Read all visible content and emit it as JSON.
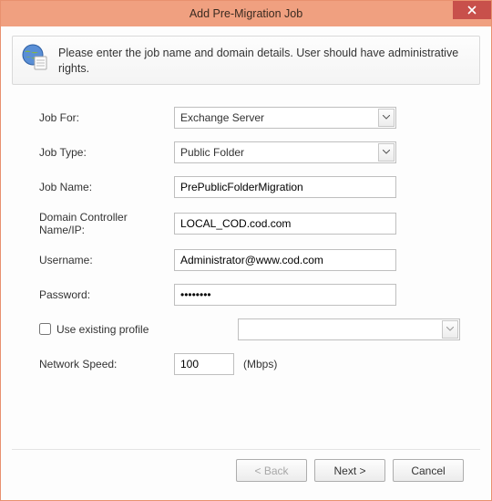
{
  "window": {
    "title": "Add Pre-Migration Job"
  },
  "banner": {
    "text": "Please enter the job name and domain details. User should have administrative rights."
  },
  "form": {
    "job_for": {
      "label": "Job For:",
      "value": "Exchange Server"
    },
    "job_type": {
      "label": "Job Type:",
      "value": "Public Folder"
    },
    "job_name": {
      "label": "Job Name:",
      "value": "PrePublicFolderMigration"
    },
    "dc": {
      "label": "Domain Controller Name/IP:",
      "value": "LOCAL_COD.cod.com"
    },
    "username": {
      "label": "Username:",
      "value": "Administrator@www.cod.com"
    },
    "password": {
      "label": "Password:",
      "value": "••••••••"
    },
    "use_existing_profile": {
      "label": "Use existing profile",
      "value": ""
    },
    "network_speed": {
      "label": "Network Speed:",
      "value": "100",
      "units": "(Mbps)"
    }
  },
  "footer": {
    "back": "< Back",
    "next": "Next >",
    "cancel": "Cancel"
  }
}
